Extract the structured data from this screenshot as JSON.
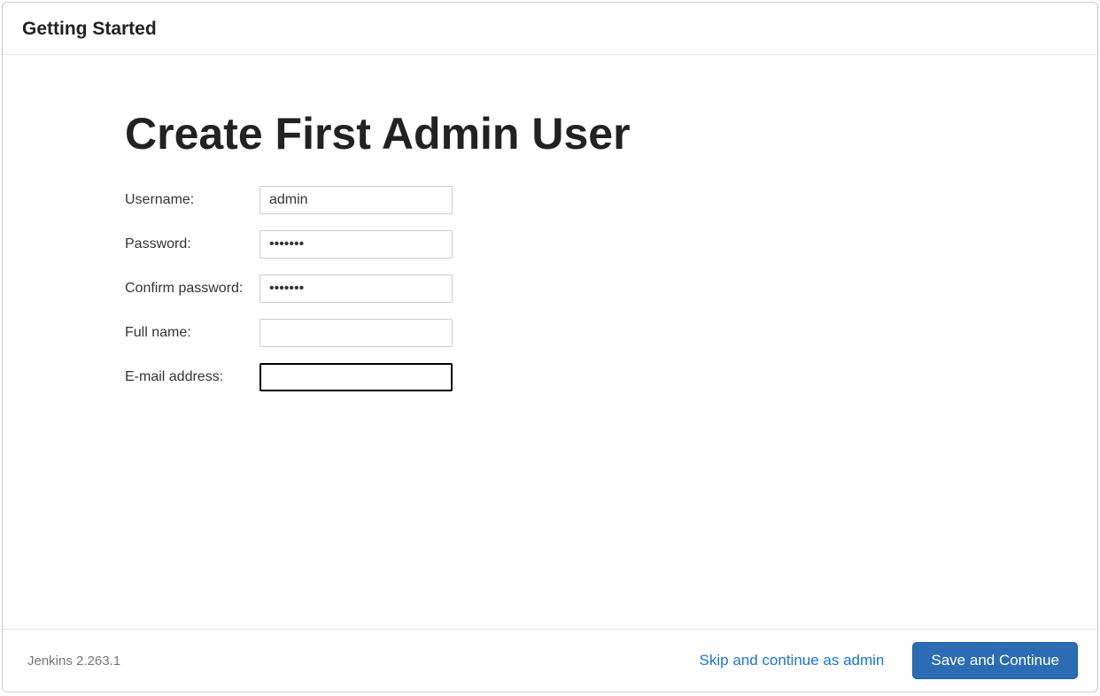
{
  "header": {
    "title": "Getting Started"
  },
  "main": {
    "title": "Create First Admin User"
  },
  "form": {
    "username": {
      "label": "Username:",
      "value": "admin"
    },
    "password": {
      "label": "Password:",
      "value": "•••••••"
    },
    "confirm_password": {
      "label": "Confirm password:",
      "value": "•••••••"
    },
    "full_name": {
      "label": "Full name:",
      "value": ""
    },
    "email": {
      "label": "E-mail address:",
      "value": ""
    }
  },
  "footer": {
    "version": "Jenkins 2.263.1",
    "skip_label": "Skip and continue as admin",
    "save_label": "Save and Continue"
  }
}
